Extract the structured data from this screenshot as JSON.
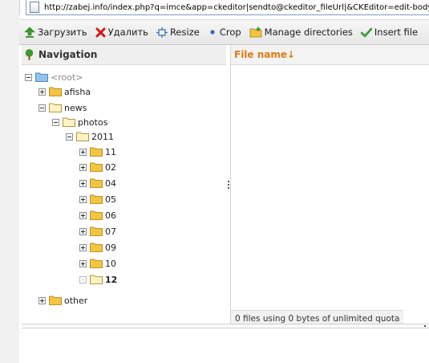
{
  "browser": {
    "url": "http://zabej.info/index.php?q=imce&app=ckeditor|sendto@ckeditor_fileUrl|&CKEditor=edit-body&"
  },
  "toolbar": {
    "upload_label": "Загрузить",
    "delete_label": "Удалить",
    "resize_label": "Resize",
    "crop_label": "Crop",
    "manage_label": "Manage directories",
    "insert_label": "Insert file"
  },
  "navigation": {
    "title": "Navigation",
    "tree": {
      "root": "<root>",
      "afisha": "afisha",
      "news": "news",
      "photos": "photos",
      "y2011": "2011",
      "m11": "11",
      "m02": "02",
      "m04": "04",
      "m05": "05",
      "m06": "06",
      "m07": "07",
      "m09": "09",
      "m10": "10",
      "m12": "12",
      "other": "other"
    }
  },
  "files": {
    "column_header": "File name↓",
    "status_text": "0 files using 0 bytes of unlimited quota"
  },
  "colors": {
    "accent": "#e07a10",
    "folder": "#f5c542",
    "root_folder": "#7db3e0"
  }
}
